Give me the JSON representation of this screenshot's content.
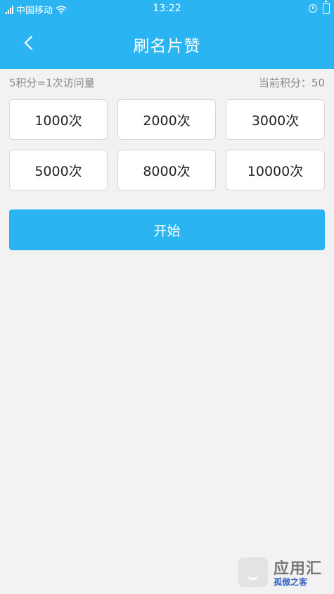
{
  "status_bar": {
    "carrier": "中国移动",
    "time": "13:22"
  },
  "nav": {
    "title": "刷名片赞",
    "back_icon": "chevron-left-icon"
  },
  "info": {
    "rate_text": "5积分=1次访问量",
    "points_label": "当前积分：",
    "points_value": "50"
  },
  "options": [
    {
      "label": "1000次"
    },
    {
      "label": "2000次"
    },
    {
      "label": "3000次"
    },
    {
      "label": "5000次"
    },
    {
      "label": "8000次"
    },
    {
      "label": "10000次"
    }
  ],
  "start_button": {
    "label": "开始"
  },
  "watermark": {
    "title": "应用汇",
    "subtitle": "孤傲之客"
  },
  "colors": {
    "accent": "#2ab4f2",
    "background": "#f2f2f2",
    "card": "#ffffff"
  }
}
